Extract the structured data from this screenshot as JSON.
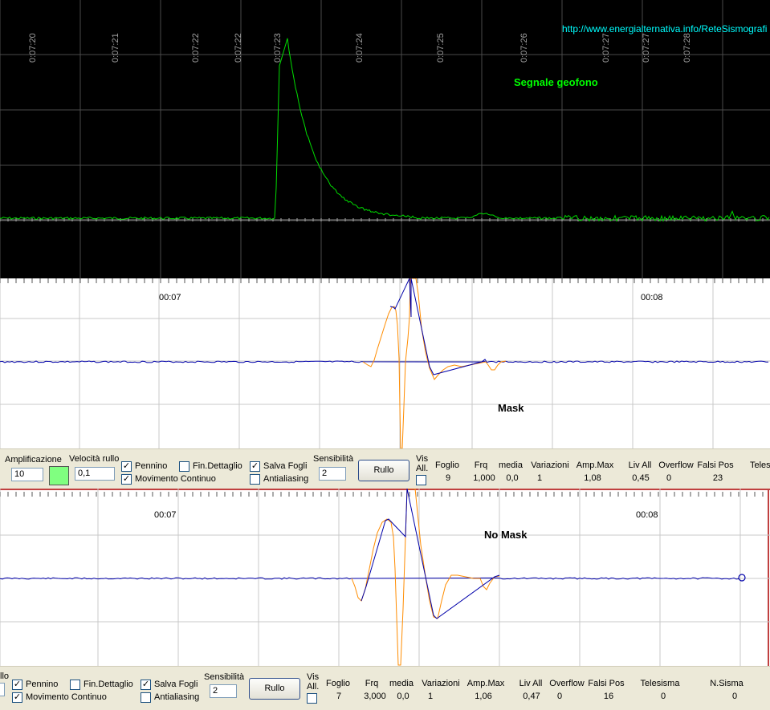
{
  "top_plot": {
    "url": "http://www.energialternativa.info/ReteSismografi",
    "title": "Segnale geofono",
    "time_labels": [
      "0:07:20",
      "0:07:21",
      "0:07:22",
      "0:07:22",
      "0:07:23",
      "0:07:24",
      "0:07:25",
      "0:07:26",
      "0:07:27",
      "0:07:27",
      "0:07:28"
    ],
    "trace_color": "#00e000",
    "background_color": "#000000"
  },
  "mask_plot": {
    "label": "Mask",
    "time_labels": [
      "00:07",
      "00:08"
    ],
    "baseline_color": "#0000aa",
    "event_color": "#ff8c00"
  },
  "nomask_plot": {
    "label": "No Mask",
    "time_labels": [
      "00:07",
      "00:08"
    ],
    "baseline_color": "#0000aa",
    "event_color": "#ff8c00"
  },
  "panel1": {
    "amplificazione_label": "Amplificazione",
    "amplificazione_value": "10",
    "velocita_label": "Velocità rullo",
    "velocita_value": "0,1",
    "pennino_label": "Pennino",
    "pennino_checked": "✓",
    "movimento_label": "Movimento Continuo",
    "movimento_checked": "✓",
    "fin_dettaglio_label": "Fin.Dettaglio",
    "salva_fogli_label": "Salva Fogli",
    "salva_fogli_checked": "✓",
    "antialiasing_label": "Antialiasing",
    "sensibilita_label": "Sensibilità",
    "sensibilita_value": "2",
    "rullo_label": "Rullo",
    "vis_label": "Vis",
    "all_label": "All.",
    "headers": [
      "Foglio",
      "Frq",
      "media",
      "Variazioni",
      "Amp.Max",
      "Liv All",
      "Overflow",
      "Falsi Pos",
      "Teles"
    ],
    "values": [
      "9",
      "1,000",
      "0,0",
      "1",
      "1,08",
      "0,45",
      "0",
      "23"
    ]
  },
  "panel2": {
    "cut_label": "llo",
    "pennino_label": "Pennino",
    "pennino_checked": "✓",
    "movimento_label": "Movimento Continuo",
    "movimento_checked": "✓",
    "fin_dettaglio_label": "Fin.Dettaglio",
    "salva_fogli_label": "Salva Fogli",
    "salva_fogli_checked": "✓",
    "antialiasing_label": "Antialiasing",
    "sensibilita_label": "Sensibilità",
    "sensibilita_value": "2",
    "rullo_label": "Rullo",
    "vis_label": "Vis",
    "all_label": "All.",
    "headers": [
      "Foglio",
      "Frq",
      "media",
      "Variazioni",
      "Amp.Max",
      "Liv All",
      "Overflow",
      "Falsi Pos",
      "Telesisma",
      "N.Sisma"
    ],
    "values": [
      "7",
      "3,000",
      "0,0",
      "1",
      "1,06",
      "0,47",
      "0",
      "16",
      "0",
      "0"
    ]
  }
}
